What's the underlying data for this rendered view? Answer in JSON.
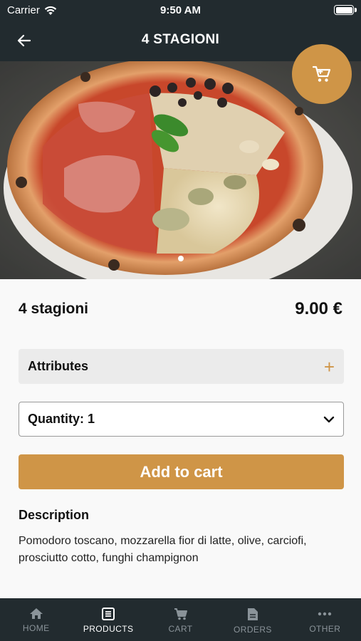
{
  "status_bar": {
    "carrier": "Carrier",
    "time": "9:50 AM"
  },
  "nav": {
    "title": "4 STAGIONI",
    "back_icon": "arrow-left-icon"
  },
  "hero": {
    "image_description": "pizza",
    "cart_icon": "cart-icon",
    "page_index": 1
  },
  "product": {
    "name": "4 stagioni",
    "price": "9.00 €",
    "attributes_label": "Attributes",
    "attributes_toggle": "+",
    "quantity_label": "Quantity: 1",
    "add_to_cart_label": "Add to cart",
    "description_title": "Description",
    "description_text": "Pomodoro toscano, mozzarella fior di latte, olive, carciofi, prosciutto cotto, funghi champignon"
  },
  "tabs": [
    {
      "label": "HOME",
      "icon": "home-icon",
      "active": false
    },
    {
      "label": "PRODUCTS",
      "icon": "list-icon",
      "active": true
    },
    {
      "label": "CART",
      "icon": "cart-icon",
      "active": false
    },
    {
      "label": "ORDERS",
      "icon": "document-icon",
      "active": false
    },
    {
      "label": "OTHER",
      "icon": "more-icon",
      "active": false
    }
  ],
  "colors": {
    "dark": "#222b2f",
    "accent": "#cf9547",
    "inactive_tab": "#8a9399"
  }
}
